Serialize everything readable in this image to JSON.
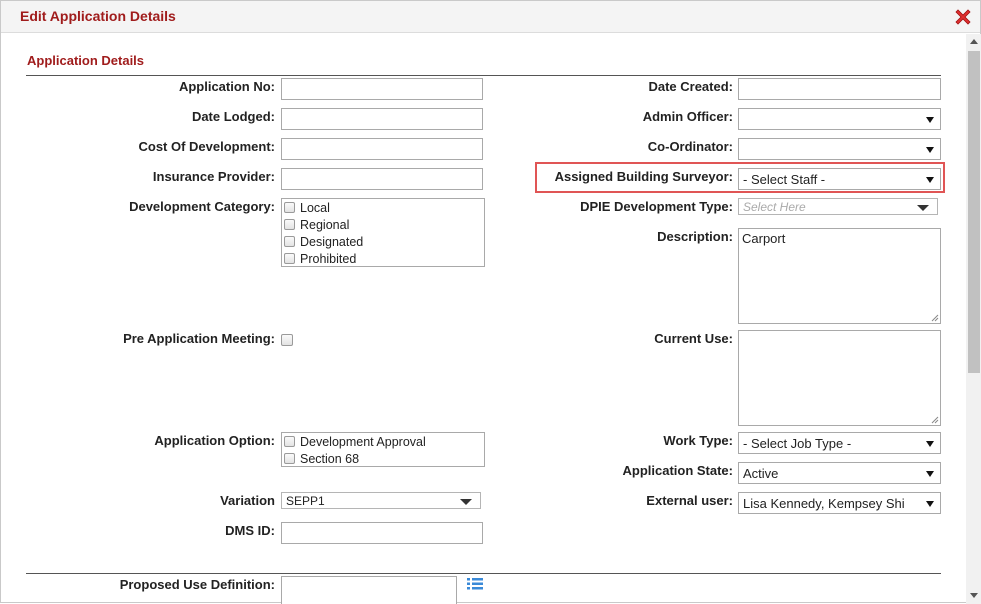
{
  "dialog": {
    "title": "Edit Application Details",
    "accent_color": "#a01c1c"
  },
  "section": {
    "title": "Application Details"
  },
  "fields": {
    "application_no": {
      "label": "Application No:",
      "value": ""
    },
    "date_lodged": {
      "label": "Date Lodged:",
      "value": ""
    },
    "cost_of_development": {
      "label": "Cost Of Development:",
      "value": ""
    },
    "insurance_provider": {
      "label": "Insurance Provider:",
      "value": ""
    },
    "development_category": {
      "label": "Development Category:",
      "options": [
        "Local",
        "Regional",
        "Designated",
        "Prohibited"
      ]
    },
    "pre_application_meeting": {
      "label": "Pre Application Meeting:"
    },
    "application_option": {
      "label": "Application Option:",
      "options": [
        "Development Approval",
        "Section 68"
      ]
    },
    "variation": {
      "label": "Variation",
      "value": "SEPP1"
    },
    "dms_id": {
      "label": "DMS ID:",
      "value": ""
    },
    "proposed_use_definition": {
      "label": "Proposed Use Definition:"
    },
    "date_created": {
      "label": "Date Created:",
      "value": ""
    },
    "admin_officer": {
      "label": "Admin Officer:",
      "value": ""
    },
    "co_ordinator": {
      "label": "Co-Ordinator:",
      "value": ""
    },
    "assigned_building_surveyor": {
      "label": "Assigned Building Surveyor:",
      "value": "- Select Staff -"
    },
    "dpie_development_type": {
      "label": "DPIE Development Type:",
      "placeholder": "Select Here"
    },
    "description": {
      "label": "Description:",
      "value": "Carport"
    },
    "current_use": {
      "label": "Current Use:",
      "value": ""
    },
    "work_type": {
      "label": "Work Type:",
      "value": "- Select Job Type -"
    },
    "application_state": {
      "label": "Application State:",
      "value": "Active"
    },
    "external_user": {
      "label": "External user:",
      "value": "Lisa Kennedy, Kempsey Shi"
    }
  },
  "highlight_color": "#e05555",
  "icons": {
    "close": "close-x-icon",
    "list": "list-icon"
  }
}
